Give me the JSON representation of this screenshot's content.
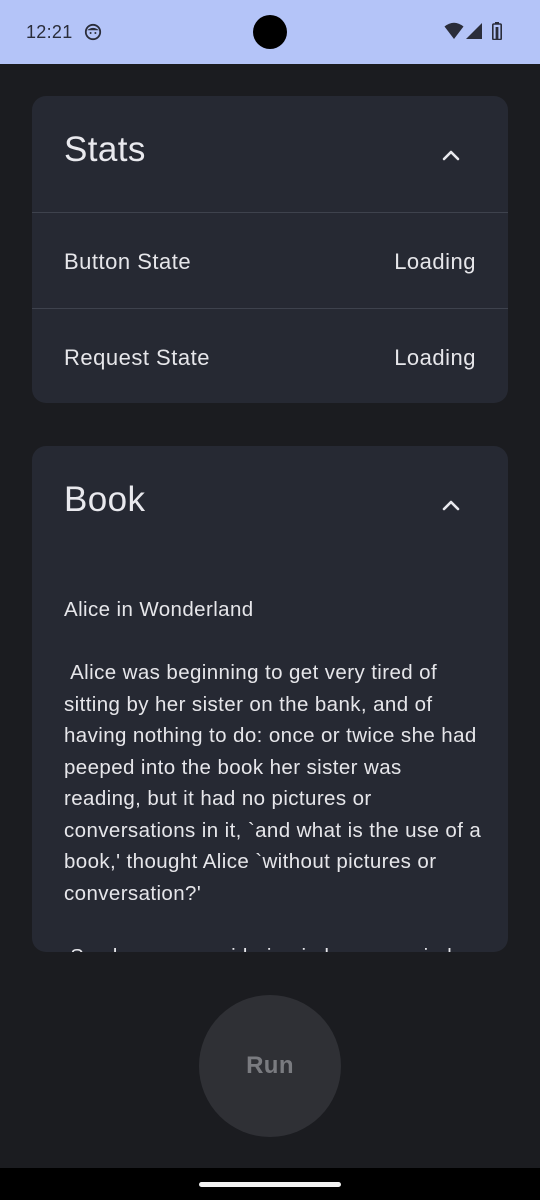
{
  "status_bar": {
    "time": "12:21",
    "app_icon": "smiley-icon",
    "icons": [
      "wifi-icon",
      "cellular-signal-icon",
      "battery-icon"
    ],
    "background_color": "#b4c4f8"
  },
  "stats_card": {
    "title": "Stats",
    "expanded": true,
    "rows": [
      {
        "label": "Button State",
        "value": "Loading"
      },
      {
        "label": "Request State",
        "value": "Loading"
      }
    ]
  },
  "book_card": {
    "title": "Book",
    "expanded": true,
    "book_title": "Alice in Wonderland",
    "paragraphs": [
      " Alice was beginning to get very tired of sitting by her sister on the bank, and of having nothing to do: once or twice she had peeped into the book her sister was reading, but it had no pictures or conversations in it, `and what is the use of a book,' thought Alice `without pictures or conversation?'",
      " So she was considering in her own mind"
    ]
  },
  "run_button": {
    "label": "Run",
    "state": "disabled"
  },
  "colors": {
    "background": "#1b1c20",
    "card": "#262933",
    "text": "#e6e6ea",
    "divider": "#3e424d",
    "button": "#2f3035",
    "button_text": "#7a7b80"
  }
}
